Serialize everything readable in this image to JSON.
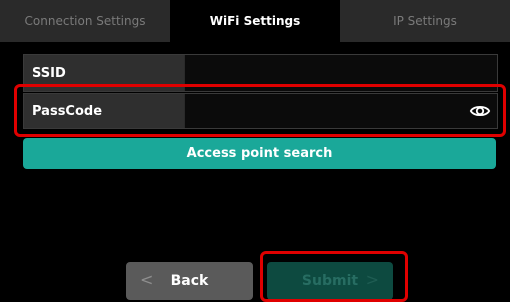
{
  "tabs": [
    {
      "label": "Connection Settings",
      "active": false
    },
    {
      "label": "WiFi Settings",
      "active": true
    },
    {
      "label": "IP Settings",
      "active": false
    }
  ],
  "form": {
    "ssid_label": "SSID",
    "ssid_value": "",
    "passcode_label": "PassCode",
    "passcode_value": "",
    "passcode_visibility_icon": "eye-icon"
  },
  "search_button_label": "Access point search",
  "footer": {
    "back_label": "Back",
    "back_icon": "chevron-left",
    "back_chevron": "<",
    "submit_label": "Submit",
    "submit_icon": "chevron-right",
    "submit_chevron": ">",
    "submit_enabled": false
  },
  "colors": {
    "accent": "#1aa899",
    "highlight": "#e00000",
    "submit_disabled": "#0d4a40"
  }
}
